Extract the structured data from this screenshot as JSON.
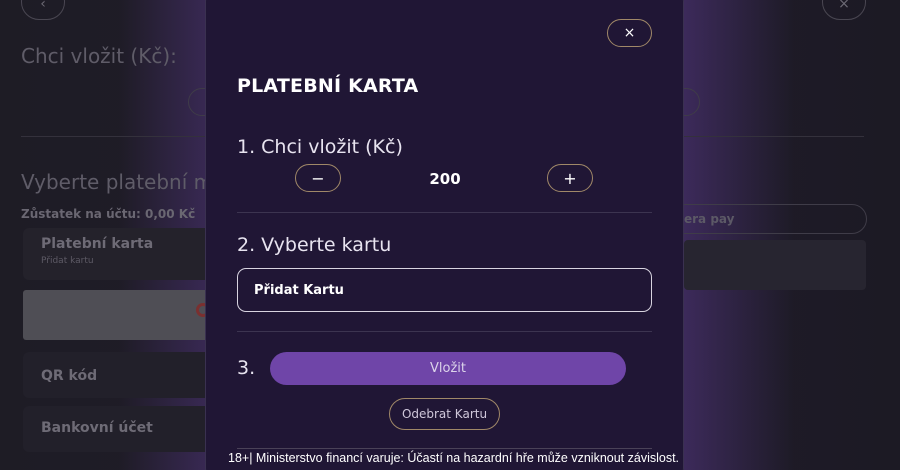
{
  "background": {
    "back_icon": "‹",
    "close_icon": "×",
    "title": "Chci vložit (Kč):",
    "method_title": "Vyberte platební me",
    "balance": "Zůstatek na účtu: 0,00 Kč",
    "methods": [
      {
        "name": "Platební karta",
        "sub": "Přidat kartu"
      },
      {
        "name": "QR kód"
      },
      {
        "name": "Bankovní účet"
      }
    ],
    "pay_label": "era pay"
  },
  "modal": {
    "close_icon": "×",
    "title": "PLATEBNÍ KARTA",
    "step1_label": "1. Chci vložit (Kč)",
    "minus_icon": "−",
    "plus_icon": "+",
    "amount": "200",
    "step2_label": "2. Vyberte kartu",
    "card_value": "Přidat Kartu",
    "step3_label": "3.",
    "deposit_label": "Vložit",
    "remove_label": "Odebrat Kartu",
    "warning": "18+| Ministerstvo financí varuje: Účastí na hazardní hře může vzniknout závislost."
  },
  "colors": {
    "modal_bg": "#201635",
    "accent": "#6f45a8",
    "outline": "#a08868"
  }
}
